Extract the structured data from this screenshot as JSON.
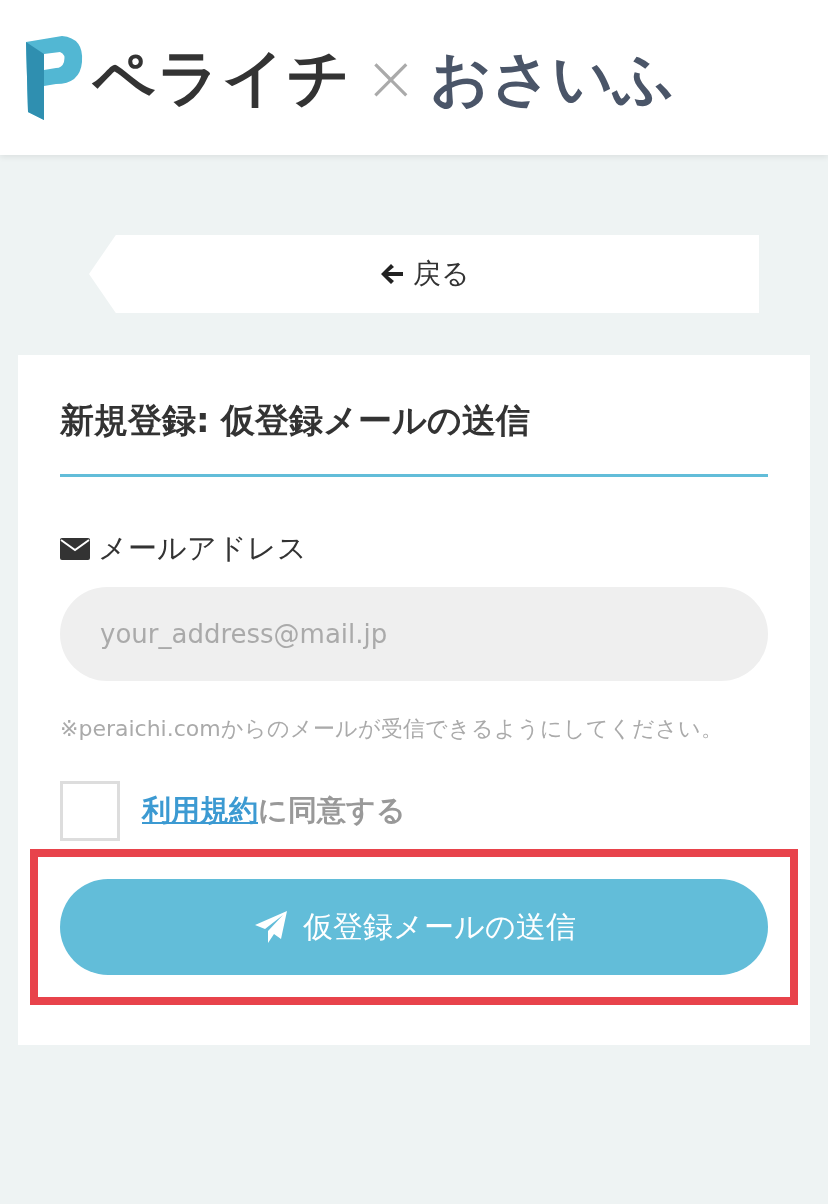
{
  "header": {
    "logo_text": "ペライチ",
    "separator": "×",
    "partner_text": "おさいふ"
  },
  "back_button": {
    "label": "戻る"
  },
  "form": {
    "title": "新規登録: 仮登録メールの送信",
    "email": {
      "label": "メールアドレス",
      "placeholder": "your_address@mail.jp"
    },
    "note": "※peraichi.comからのメールが受信できるようにしてください。",
    "terms": {
      "checked": false,
      "link": "利用規約",
      "text": "に同意する"
    },
    "submit": {
      "label": "仮登録メールの送信",
      "highlighted": true
    }
  }
}
